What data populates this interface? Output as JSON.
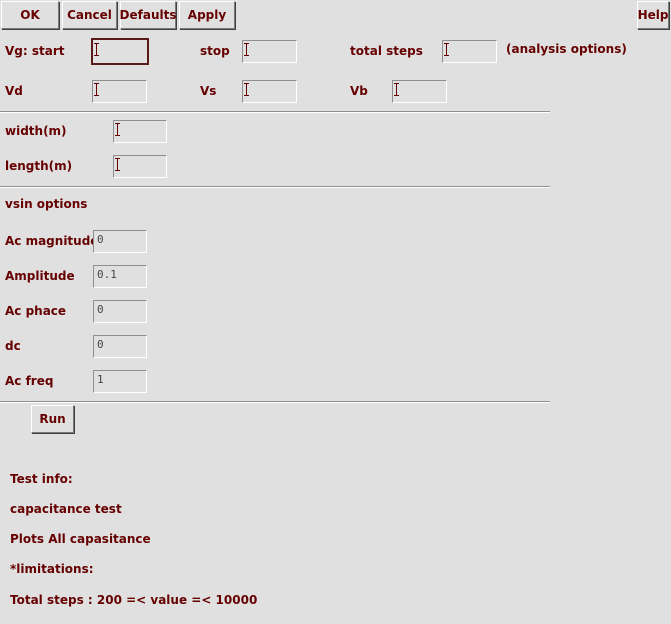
{
  "toolbar": {
    "ok": "OK",
    "cancel": "Cancel",
    "defaults": "Defaults",
    "apply": "Apply",
    "help": "Help"
  },
  "sweep": {
    "vg_start_label": "Vg: start",
    "vg_start_value": "",
    "stop_label": "stop",
    "stop_value": "",
    "total_steps_label": "total steps",
    "total_steps_value": "",
    "analysis_options": "(analysis options)",
    "vd_label": "Vd",
    "vd_value": "",
    "vs_label": "Vs",
    "vs_value": "",
    "vb_label": "Vb",
    "vb_value": ""
  },
  "geometry": {
    "width_label": "width(m)",
    "width_value": "",
    "length_label": "length(m)",
    "length_value": ""
  },
  "vsin": {
    "title": "vsin options",
    "ac_magnitude_label": "Ac magnitude",
    "ac_magnitude_value": "0",
    "amplitude_label": "Amplitude",
    "amplitude_value": "0.1",
    "ac_phace_label": "Ac phace",
    "ac_phace_value": "0",
    "dc_label": "dc",
    "dc_value": "0",
    "ac_freq_label": "Ac freq",
    "ac_freq_value": "1"
  },
  "run_label": "Run",
  "test_info": {
    "heading": "Test info:",
    "line1": "capacitance test",
    "line2": "Plots All capasitance",
    "line3": "*limitations:",
    "line4": "Total steps : 200 =< value =< 10000"
  }
}
